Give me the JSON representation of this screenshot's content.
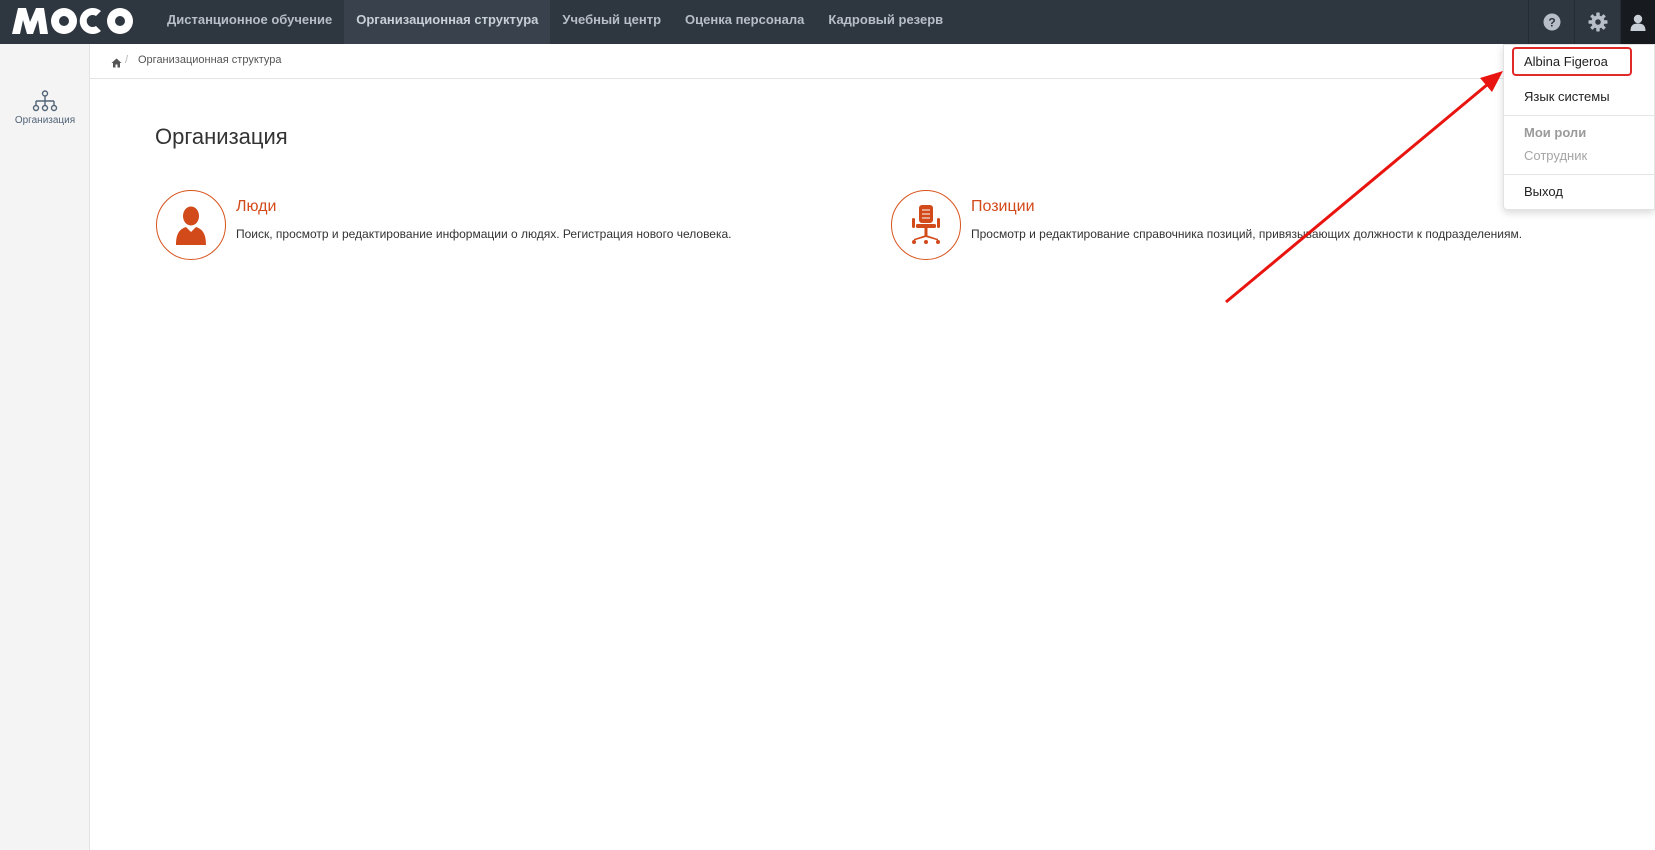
{
  "header": {
    "logo_text": "MOCO",
    "nav": [
      {
        "label": "Дистанционное обучение"
      },
      {
        "label": "Организационная структура"
      },
      {
        "label": "Учебный центр"
      },
      {
        "label": "Оценка персонала"
      },
      {
        "label": "Кадровый резерв"
      }
    ],
    "icons": [
      "help-icon",
      "gear-icon",
      "user-icon"
    ]
  },
  "sidebar": {
    "items": [
      {
        "label": "Организация",
        "icon": "org-structure-icon"
      }
    ]
  },
  "breadcrumb": {
    "separator": "/",
    "current": "Организационная структура"
  },
  "main": {
    "title": "Организация",
    "cards": [
      {
        "title": "Люди",
        "description": "Поиск, просмотр и редактирование информации о людях. Регистрация нового человека.",
        "icon": "person-icon"
      },
      {
        "title": "Позиции",
        "description": "Просмотр и редактирование справочника позиций, привязывающих должности к подразделениям.",
        "icon": "office-chair-icon"
      }
    ]
  },
  "user_menu": {
    "user_name": "Albina Figeroa",
    "language": "Язык системы",
    "roles_header": "Мои роли",
    "role": "Сотрудник",
    "logout": "Выход"
  },
  "colors": {
    "topbar": "#2e3640",
    "accent": "#d2491a",
    "highlight": "#e02a2a"
  }
}
